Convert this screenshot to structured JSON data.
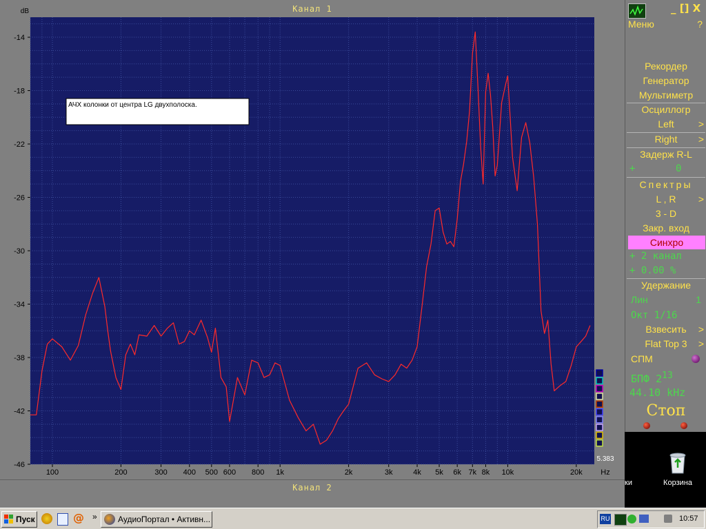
{
  "analyzer": {
    "channel_top": "Канал 1",
    "channel_bottom": "Канал 2",
    "annotation": "АЧХ  колонки от центра LG  двухполоска.",
    "scale_value": "5.383",
    "swatch_colors": [
      "#0000a0",
      "#00c0c0",
      "#c000c0",
      "#e0e0a0",
      "#c04000",
      "#4040ff",
      "#8080ff",
      "#c0a0ff",
      "#e0c000",
      "#c0e040"
    ]
  },
  "chart_data": {
    "type": "line",
    "title": "Канал 1",
    "ylabel": "dB",
    "xlabel": "Hz",
    "xscale": "log",
    "xlim": [
      80,
      24000
    ],
    "ylim": [
      -46,
      -12.5
    ],
    "yticks": [
      -14,
      -18,
      -22,
      -26,
      -30,
      -34,
      -38,
      -42,
      -46
    ],
    "xticks": [
      {
        "v": 100,
        "label": "100"
      },
      {
        "v": 200,
        "label": "200"
      },
      {
        "v": 300,
        "label": "300"
      },
      {
        "v": 400,
        "label": "400"
      },
      {
        "v": 500,
        "label": "500"
      },
      {
        "v": 600,
        "label": "600"
      },
      {
        "v": 800,
        "label": "800"
      },
      {
        "v": 1000,
        "label": "1k"
      },
      {
        "v": 2000,
        "label": "2k"
      },
      {
        "v": 3000,
        "label": "3k"
      },
      {
        "v": 4000,
        "label": "4k"
      },
      {
        "v": 5000,
        "label": "5k"
      },
      {
        "v": 6000,
        "label": "6k"
      },
      {
        "v": 7000,
        "label": "7k"
      },
      {
        "v": 8000,
        "label": "8k"
      },
      {
        "v": 10000,
        "label": "10k"
      },
      {
        "v": 20000,
        "label": "20k"
      }
    ],
    "grid": true,
    "colors": {
      "background": "#161c66",
      "grid": "#3a4a9a",
      "line": "#ff2a2a",
      "axis_text": "#000000"
    },
    "series": [
      {
        "x": [
          80,
          85,
          90,
          95,
          100,
          110,
          120,
          130,
          140,
          150,
          160,
          170,
          175,
          180,
          190,
          200,
          210,
          220,
          230,
          240,
          260,
          280,
          300,
          320,
          340,
          360,
          380,
          400,
          420,
          450,
          480,
          500,
          520,
          550,
          580,
          600,
          650,
          700,
          750,
          800,
          850,
          900,
          950,
          1000,
          1100,
          1200,
          1300,
          1400,
          1500,
          1600,
          1700,
          1800,
          1900,
          2000,
          2200,
          2400,
          2600,
          2800,
          3000,
          3200,
          3400,
          3600,
          3800,
          4000,
          4200,
          4400,
          4600,
          4800,
          5000,
          5200,
          5400,
          5600,
          5800,
          6000,
          6200,
          6400,
          6600,
          6800,
          7000,
          7200,
          7400,
          7600,
          7800,
          8000,
          8200,
          8400,
          8600,
          8800,
          9000,
          9400,
          9800,
          10000,
          10500,
          11000,
          11500,
          12000,
          12500,
          13000,
          13500,
          14000,
          14500,
          15000,
          15500,
          16000,
          17000,
          18000,
          19000,
          20000,
          21000,
          22000,
          23000
        ],
        "y": [
          -42.3,
          -42.3,
          -39,
          -37,
          -36.6,
          -37.2,
          -38.2,
          -37.1,
          -34.8,
          -33.2,
          -32,
          -34.2,
          -36,
          -37.5,
          -39.5,
          -40.4,
          -37.8,
          -37,
          -37.8,
          -36.3,
          -36.4,
          -35.6,
          -36.4,
          -35.8,
          -35.4,
          -37,
          -36.8,
          -36,
          -36.3,
          -35.2,
          -36.5,
          -37.6,
          -35.8,
          -39.5,
          -40.2,
          -42.8,
          -39.5,
          -40.8,
          -38.2,
          -38.4,
          -39.5,
          -39.3,
          -38.4,
          -38.6,
          -41.2,
          -42.5,
          -43.5,
          -43,
          -44.5,
          -44.2,
          -43.5,
          -42.6,
          -42,
          -41.5,
          -38.8,
          -38.4,
          -39.3,
          -39.6,
          -39.8,
          -39.3,
          -38.5,
          -38.8,
          -38.2,
          -37.2,
          -34.2,
          -31.2,
          -29.5,
          -27,
          -26.8,
          -28.6,
          -29.5,
          -29.3,
          -29.7,
          -27.6,
          -24.8,
          -23.5,
          -21.8,
          -19.5,
          -15.2,
          -13.6,
          -17.8,
          -22.2,
          -25,
          -18.1,
          -16.7,
          -18.3,
          -20.8,
          -24.4,
          -23.6,
          -18.9,
          -17.5,
          -16.9,
          -23,
          -25.5,
          -21.5,
          -20.4,
          -21.9,
          -24.5,
          -28,
          -34.5,
          -36.2,
          -35.2,
          -38.5,
          -40.5,
          -40.1,
          -39.8,
          -38.6,
          -37.2,
          -36.8,
          -36.4,
          -35.6
        ]
      }
    ]
  },
  "right_panel": {
    "menu": "Меню",
    "help": "?",
    "window_controls": "_ [] X",
    "recorder": "Рекордер",
    "generator": "Генератор",
    "multimeter": "Мультиметр",
    "oscilloscope": "Осциллогр",
    "left": "Left",
    "right": "Right",
    "delay": "Задерж R-L",
    "delay_sign": "+",
    "delay_value": "0",
    "spectra": "Спектры",
    "lr": "L , R",
    "three_d": "3 - D",
    "closed_input": "Закр. вход",
    "sync": "Синхро",
    "sync_channel": "+ 2 канал",
    "sync_level": "+ 0.00 %",
    "hold": "Удержание",
    "lin": "Лин",
    "lin_value": "1",
    "oct": "Окт 1/16",
    "weight": "Взвесить",
    "window": "Flat Top 3",
    "spm": "СПМ",
    "fft": "БПФ 2",
    "fft_exp": "13",
    "sample_rate": "44.10 kHz",
    "stop": "Стоп",
    "arrow": ">"
  },
  "desktop": {
    "left_label": "ки",
    "recycle_bin": "Корзина"
  },
  "taskbar": {
    "start": "Пуск",
    "task": "АудиоПортал • Активн...",
    "lang": "RU",
    "clock": "10:57",
    "chevron": "»"
  }
}
